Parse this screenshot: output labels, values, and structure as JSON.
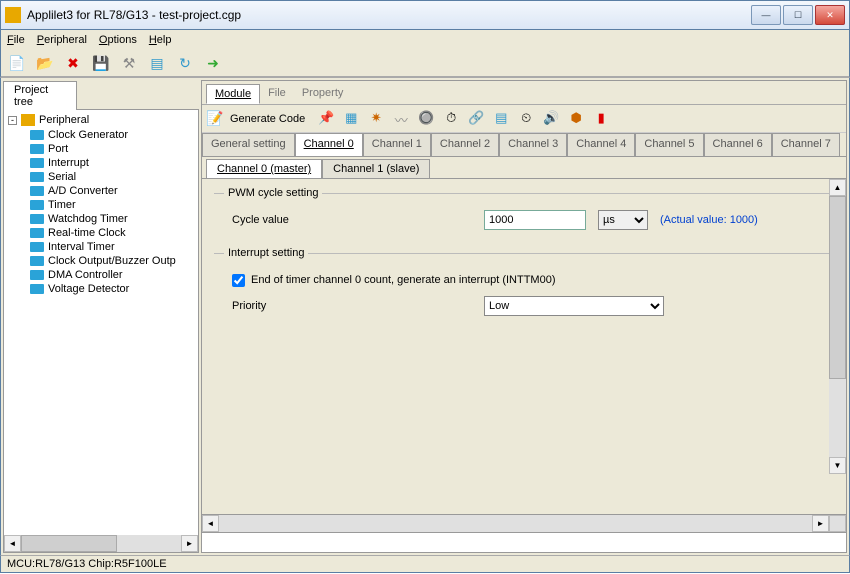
{
  "window": {
    "title": "Applilet3 for RL78/G13 - test-project.cgp"
  },
  "menu": {
    "file": "File",
    "peripheral": "Peripheral",
    "options": "Options",
    "help": "Help"
  },
  "tree": {
    "title": "Project tree",
    "root": "Peripheral",
    "items": [
      "Clock Generator",
      "Port",
      "Interrupt",
      "Serial",
      "A/D Converter",
      "Timer",
      "Watchdog Timer",
      "Real-time Clock",
      "Interval Timer",
      "Clock Output/Buzzer Outp",
      "DMA Controller",
      "Voltage Detector"
    ]
  },
  "topTabs": {
    "module": "Module",
    "file": "File",
    "property": "Property"
  },
  "generate": {
    "label": "Generate Code"
  },
  "channelTabs": {
    "general": "General setting",
    "channels": [
      "Channel 0",
      "Channel 1",
      "Channel 2",
      "Channel 3",
      "Channel 4",
      "Channel 5",
      "Channel 6",
      "Channel 7"
    ],
    "active": "Channel 0"
  },
  "subTabs": {
    "master": "Channel 0 (master)",
    "slave": "Channel 1 (slave)"
  },
  "pwm": {
    "legend": "PWM cycle setting",
    "cycleLabel": "Cycle value",
    "cycleValue": "1000",
    "unit": "µs",
    "actual": "(Actual value: 1000)"
  },
  "interrupt": {
    "legend": "Interrupt setting",
    "checkboxLabel": "End of timer channel 0 count, generate an interrupt (INTTM00)",
    "checked": true,
    "priorityLabel": "Priority",
    "priorityValue": "Low"
  },
  "status": {
    "text": "MCU:RL78/G13  Chip:R5F100LE"
  }
}
